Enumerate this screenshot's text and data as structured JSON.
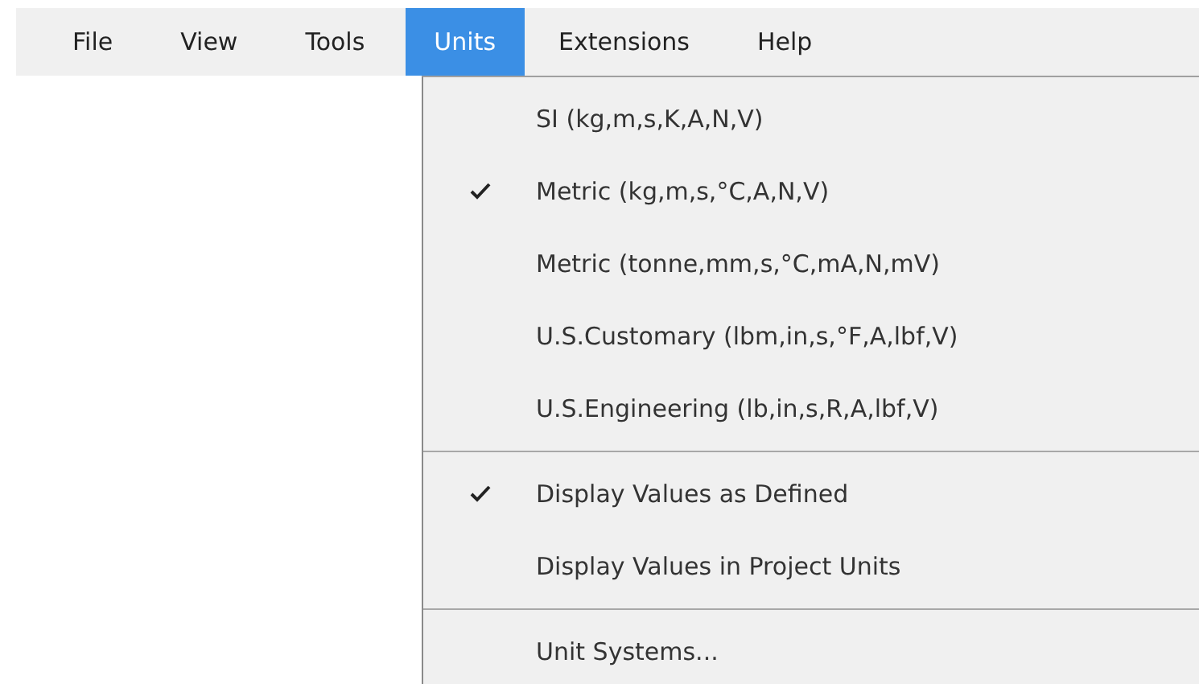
{
  "menu_bar": [
    {
      "label": "File",
      "selected": false
    },
    {
      "label": "View",
      "selected": false
    },
    {
      "label": "Tools",
      "selected": false
    },
    {
      "label": "Units",
      "selected": true
    },
    {
      "label": "Extensions",
      "selected": false
    },
    {
      "label": "Help",
      "selected": false
    }
  ],
  "units_menu": [
    {
      "kind": "item",
      "label": "SI (kg,m,s,K,A,N,V)",
      "checked": false
    },
    {
      "kind": "item",
      "label": "Metric (kg,m,s,°C,A,N,V)",
      "checked": true
    },
    {
      "kind": "item",
      "label": "Metric (tonne,mm,s,°C,mA,N,mV)",
      "checked": false
    },
    {
      "kind": "item",
      "label": "U.S.Customary (lbm,in,s,°F,A,lbf,V)",
      "checked": false
    },
    {
      "kind": "item",
      "label": "U.S.Engineering (lb,in,s,R,A,lbf,V)",
      "checked": false
    },
    {
      "kind": "separator"
    },
    {
      "kind": "item",
      "label": "Display Values as Defined",
      "checked": true
    },
    {
      "kind": "item",
      "label": "Display Values in Project Units",
      "checked": false
    },
    {
      "kind": "separator"
    },
    {
      "kind": "item",
      "label": "Unit Systems...",
      "checked": false
    }
  ]
}
